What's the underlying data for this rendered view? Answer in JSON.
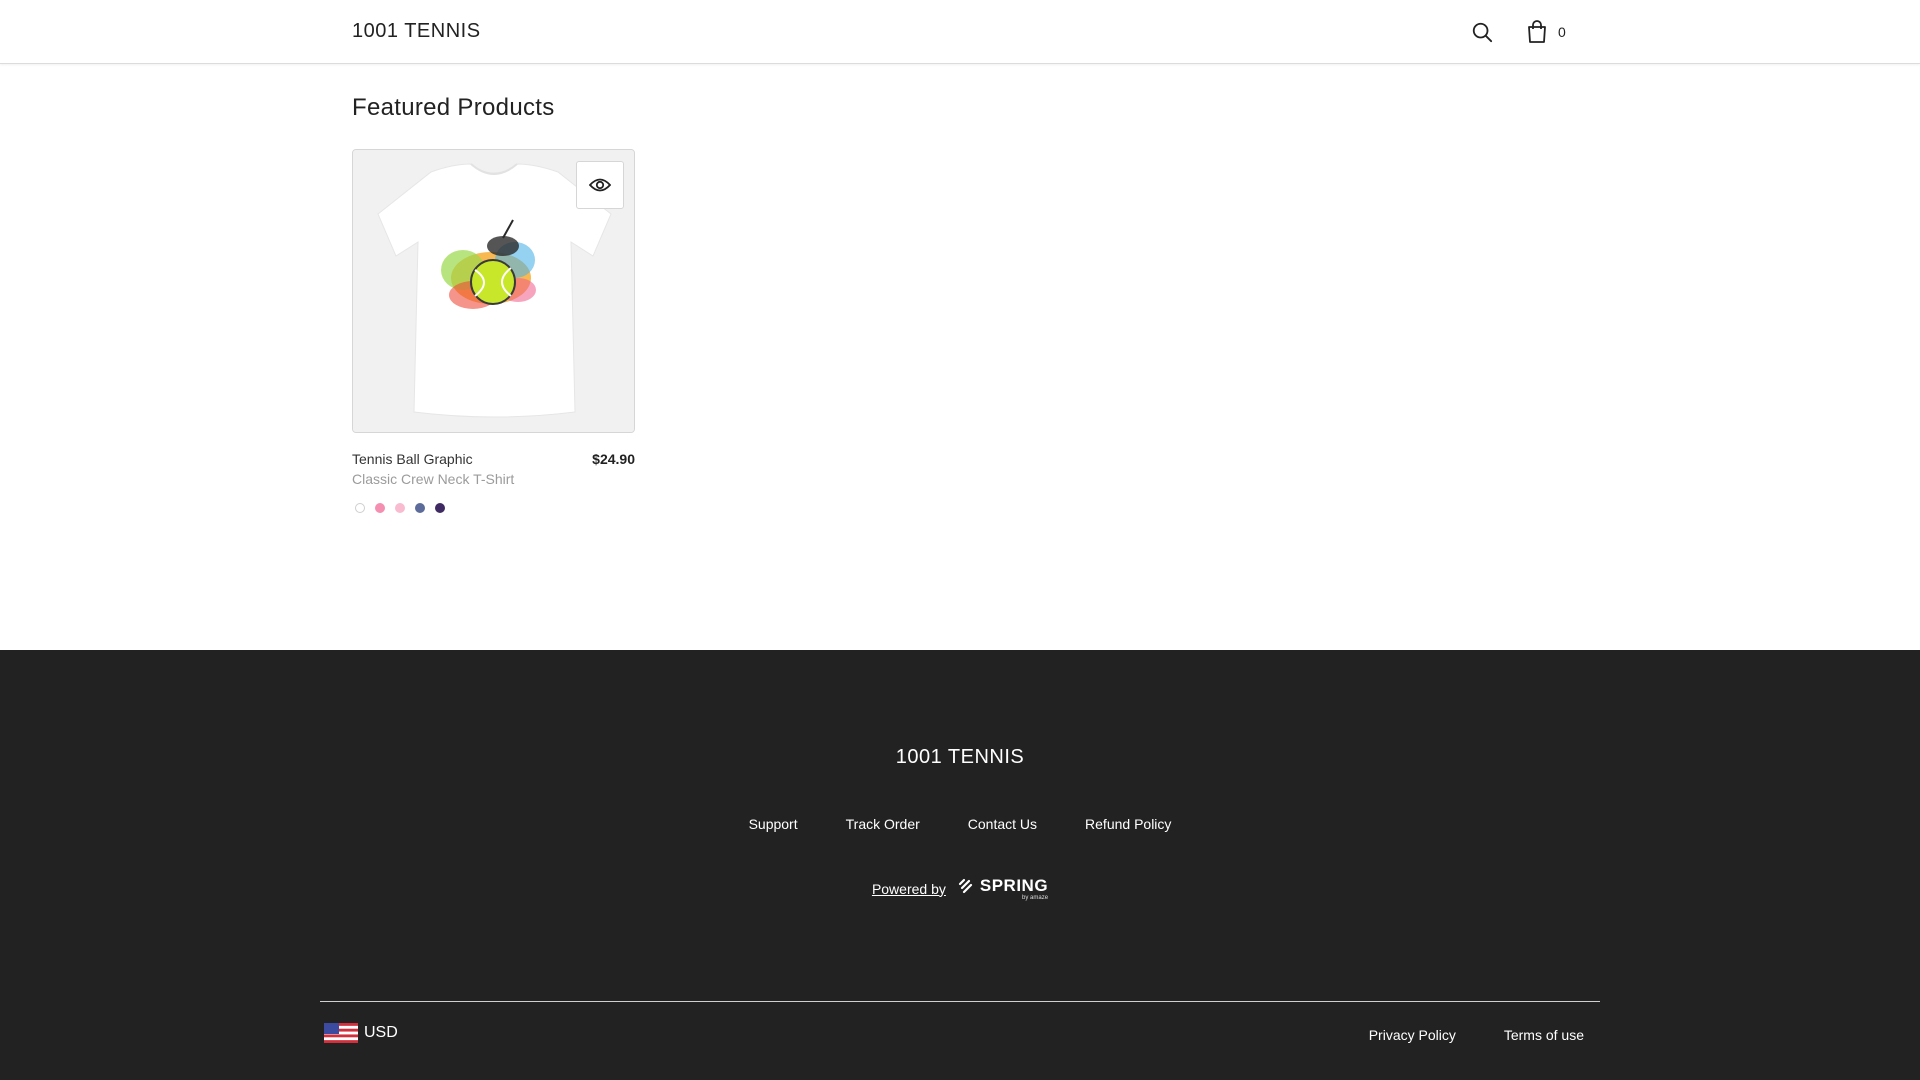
{
  "header": {
    "brand": "1001 TENNIS",
    "search_icon": "search-icon",
    "cart_icon": "shopping-bag-icon",
    "cart_count": "0"
  },
  "main": {
    "section_title": "Featured Products",
    "products": [
      {
        "name": "Tennis Ball Graphic",
        "subtitle": "Classic Crew Neck T-Shirt",
        "price": "$24.90",
        "quickview_icon": "eye-icon",
        "swatches": [
          "#ffffff",
          "#f48fb1",
          "#f8bbd0",
          "#5c6b99",
          "#3f2a63"
        ]
      }
    ]
  },
  "footer": {
    "brand": "1001 TENNIS",
    "links": [
      "Support",
      "Track Order",
      "Contact Us",
      "Refund Policy"
    ],
    "powered_by": "Powered by",
    "spring_word": "SPRING",
    "spring_sub": "by amaze",
    "currency": "USD",
    "currency_flag_icon": "us-flag-icon",
    "legal_links": [
      "Privacy Policy",
      "Terms of use"
    ]
  },
  "colors": {
    "footer_bg": "#222222",
    "header_border": "#dcdcdc"
  }
}
